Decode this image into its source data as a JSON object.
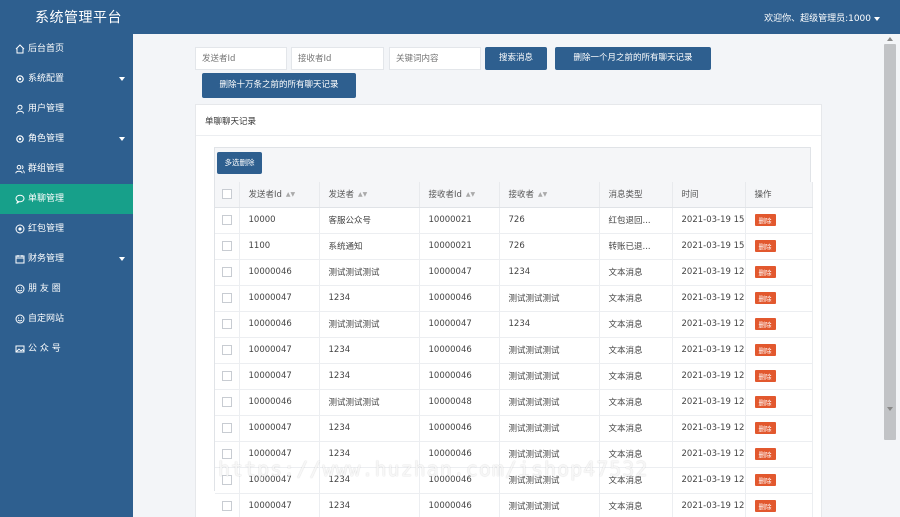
{
  "header": {
    "title": "系统管理平台",
    "user": "欢迎你、超级管理员:1000"
  },
  "sidebar": {
    "items": [
      {
        "label": "后台首页",
        "icon": "home-icon",
        "active": false,
        "has_submenu": false
      },
      {
        "label": "系统配置",
        "icon": "gear-icon",
        "active": false,
        "has_submenu": true
      },
      {
        "label": "用户管理",
        "icon": "user-icon",
        "active": false,
        "has_submenu": false
      },
      {
        "label": "角色管理",
        "icon": "gear-icon",
        "active": false,
        "has_submenu": true
      },
      {
        "label": "群组管理",
        "icon": "group-icon",
        "active": false,
        "has_submenu": false
      },
      {
        "label": "单聊管理",
        "icon": "chat-icon",
        "active": true,
        "has_submenu": false
      },
      {
        "label": "红包管理",
        "icon": "redpacket-icon",
        "active": false,
        "has_submenu": false
      },
      {
        "label": "财务管理",
        "icon": "calendar-icon",
        "active": false,
        "has_submenu": true
      },
      {
        "label": "朋 友 圈",
        "icon": "smile-icon",
        "active": false,
        "has_submenu": false
      },
      {
        "label": "自定网站",
        "icon": "smile-icon",
        "active": false,
        "has_submenu": false
      },
      {
        "label": "公 众 号",
        "icon": "image-icon",
        "active": false,
        "has_submenu": false
      }
    ]
  },
  "filters": {
    "sender_id_placeholder": "发送者Id",
    "receiver_id_placeholder": "接收者Id",
    "keyword_placeholder": "关键词内容",
    "search_label": "搜索消息",
    "delete_month_label": "删除一个月之前的所有聊天记录",
    "delete_100k_label": "删除十万条之前的所有聊天记录"
  },
  "panel": {
    "title": "单聊聊天记录",
    "multi_delete_label": "多选删除"
  },
  "table": {
    "headers": [
      "发送者Id",
      "发送者",
      "接收者Id",
      "接收者",
      "消息类型",
      "时间",
      "操作"
    ],
    "delete_label": "删除",
    "rows": [
      [
        "10000",
        "客服公众号",
        "10000021",
        "726",
        "红包退回...",
        "2021-03-19 15"
      ],
      [
        "1100",
        "系统通知",
        "10000021",
        "726",
        "转账已退...",
        "2021-03-19 15"
      ],
      [
        "10000046",
        "测试测试测试",
        "10000047",
        "1234",
        "文本消息",
        "2021-03-19 12"
      ],
      [
        "10000047",
        "1234",
        "10000046",
        "测试测试测试",
        "文本消息",
        "2021-03-19 12"
      ],
      [
        "10000046",
        "测试测试测试",
        "10000047",
        "1234",
        "文本消息",
        "2021-03-19 12"
      ],
      [
        "10000047",
        "1234",
        "10000046",
        "测试测试测试",
        "文本消息",
        "2021-03-19 12"
      ],
      [
        "10000047",
        "1234",
        "10000046",
        "测试测试测试",
        "文本消息",
        "2021-03-19 12"
      ],
      [
        "10000046",
        "测试测试测试",
        "10000048",
        "测试测试测试",
        "文本消息",
        "2021-03-19 12"
      ],
      [
        "10000047",
        "1234",
        "10000046",
        "测试测试测试",
        "文本消息",
        "2021-03-19 12"
      ],
      [
        "10000047",
        "1234",
        "10000046",
        "测试测试测试",
        "文本消息",
        "2021-03-19 12"
      ],
      [
        "10000047",
        "1234",
        "10000046",
        "测试测试测试",
        "文本消息",
        "2021-03-19 12"
      ],
      [
        "10000047",
        "1234",
        "10000046",
        "测试测试测试",
        "文本消息",
        "2021-03-19 12"
      ]
    ]
  },
  "watermark": "https://www.huzhan.com/ishop47532",
  "colors": {
    "primary": "#2e5f8f",
    "active": "#17a08a",
    "danger": "#e2582e"
  }
}
